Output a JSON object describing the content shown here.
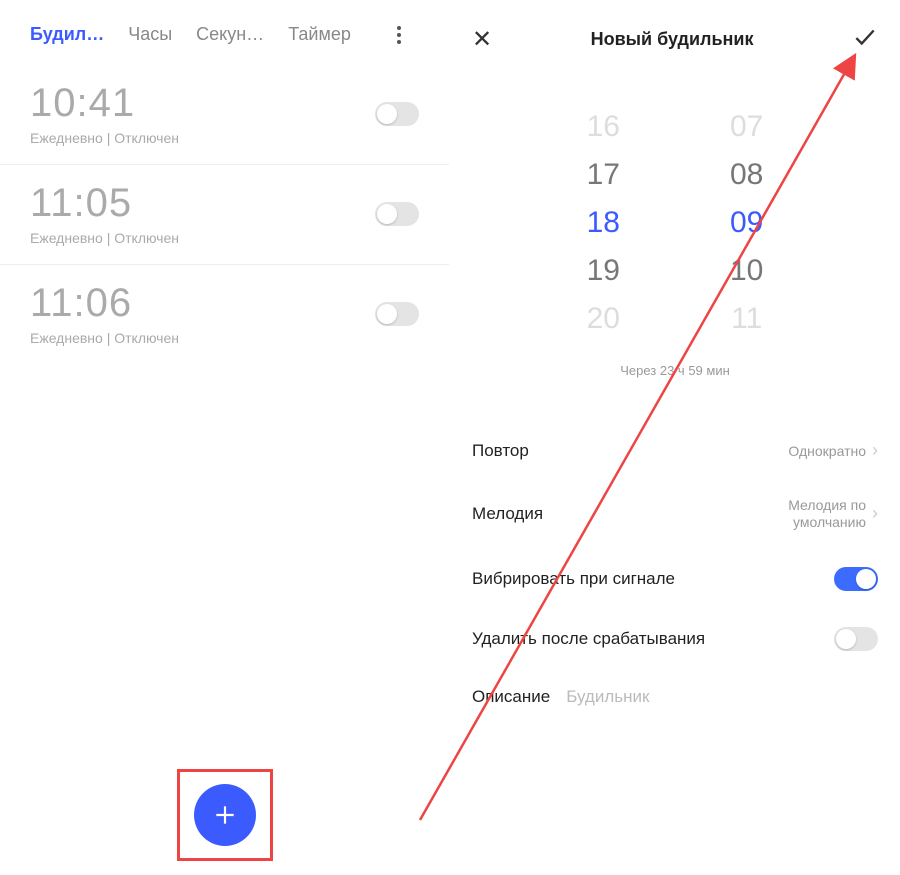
{
  "left": {
    "tabs": [
      "Будил…",
      "Часы",
      "Секун…",
      "Таймер"
    ],
    "active_tab_index": 0,
    "alarms": [
      {
        "time": "10:41",
        "desc": "Ежедневно | Отключен",
        "on": false
      },
      {
        "time": "11:05",
        "desc": "Ежедневно | Отключен",
        "on": false
      },
      {
        "time": "11:06",
        "desc": "Ежедневно | Отключен",
        "on": false
      }
    ]
  },
  "right": {
    "title": "Новый будильник",
    "picker": {
      "hours": [
        "16",
        "17",
        "18",
        "19",
        "20"
      ],
      "minutes": [
        "07",
        "08",
        "09",
        "10",
        "11"
      ],
      "selected_index": 2
    },
    "time_until": "Через 23 ч 59 мин",
    "settings": {
      "repeat_label": "Повтор",
      "repeat_value": "Однократно",
      "ringtone_label": "Мелодия",
      "ringtone_value": "Мелодия по умолчанию",
      "vibrate_label": "Вибрировать при сигнале",
      "vibrate_on": true,
      "delete_after_label": "Удалить после срабатывания",
      "delete_after_on": false,
      "description_label": "Описание",
      "description_placeholder": "Будильник"
    }
  },
  "annotation": {
    "arrow_color": "#e44",
    "highlight_fab": true
  }
}
